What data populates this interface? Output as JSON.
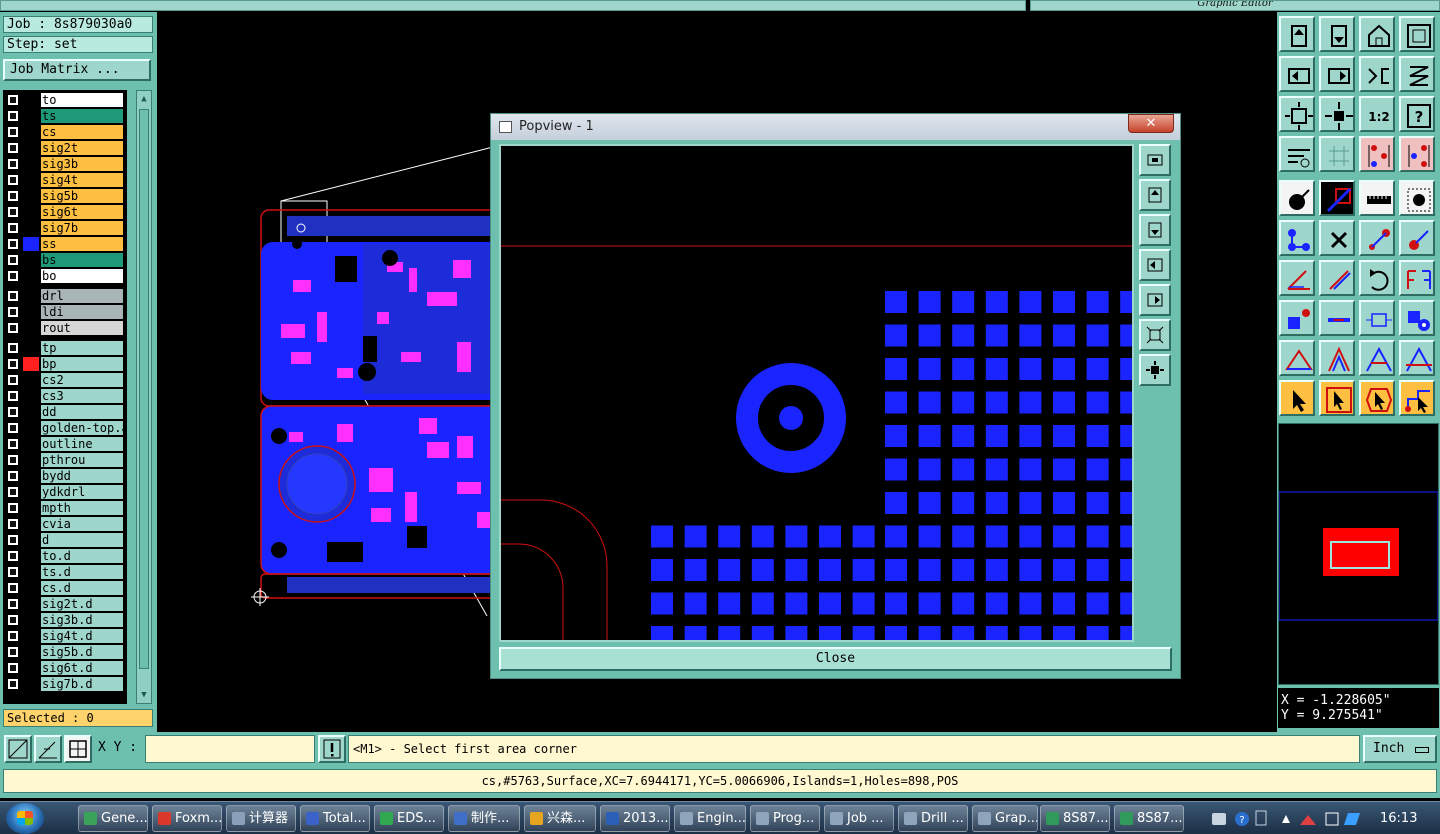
{
  "window": {
    "right_title": "Graphic Editor"
  },
  "job": {
    "job_line": "Job : 8s879030a0",
    "step_line": "Step: set",
    "matrix_button": "Job Matrix ..."
  },
  "layers": [
    {
      "name": "to",
      "color": "#ffffff",
      "swatch": ""
    },
    {
      "name": "ts",
      "color": "#1e9a78",
      "swatch": ""
    },
    {
      "name": "cs",
      "color": "#ffbf40",
      "swatch": ""
    },
    {
      "name": "sig2t",
      "color": "#ffbf40",
      "swatch": ""
    },
    {
      "name": "sig3b",
      "color": "#ffbf40",
      "swatch": ""
    },
    {
      "name": "sig4t",
      "color": "#ffbf40",
      "swatch": ""
    },
    {
      "name": "sig5b",
      "color": "#ffbf40",
      "swatch": ""
    },
    {
      "name": "sig6t",
      "color": "#ffbf40",
      "swatch": ""
    },
    {
      "name": "sig7b",
      "color": "#ffbf40",
      "swatch": ""
    },
    {
      "name": "ss",
      "color": "#ffbf40",
      "swatch": "#1a24ff"
    },
    {
      "name": "bs",
      "color": "#1e9a78",
      "swatch": ""
    },
    {
      "name": "bo",
      "color": "#ffffff",
      "swatch": ""
    },
    {
      "name": "drl",
      "color": "#a9b4b8",
      "swatch": ""
    },
    {
      "name": "ldi",
      "color": "#a9b4b8",
      "swatch": ""
    },
    {
      "name": "rout",
      "color": "#d6d6d6",
      "swatch": ""
    },
    {
      "name": "tp",
      "color": "#9fd6cc",
      "swatch": ""
    },
    {
      "name": "bp",
      "color": "#9fd6cc",
      "swatch": "#ff2020"
    },
    {
      "name": "cs2",
      "color": "#9fd6cc",
      "swatch": ""
    },
    {
      "name": "cs3",
      "color": "#9fd6cc",
      "swatch": ""
    },
    {
      "name": "dd",
      "color": "#9fd6cc",
      "swatch": ""
    },
    {
      "name": "golden-top.a",
      "color": "#9fd6cc",
      "swatch": ""
    },
    {
      "name": "outline",
      "color": "#9fd6cc",
      "swatch": ""
    },
    {
      "name": "pthrou",
      "color": "#9fd6cc",
      "swatch": ""
    },
    {
      "name": "bydd",
      "color": "#9fd6cc",
      "swatch": ""
    },
    {
      "name": "ydkdrl",
      "color": "#9fd6cc",
      "swatch": ""
    },
    {
      "name": "mpth",
      "color": "#9fd6cc",
      "swatch": ""
    },
    {
      "name": "cvia",
      "color": "#9fd6cc",
      "swatch": ""
    },
    {
      "name": "d",
      "color": "#9fd6cc",
      "swatch": ""
    },
    {
      "name": "to.d",
      "color": "#9fd6cc",
      "swatch": ""
    },
    {
      "name": "ts.d",
      "color": "#9fd6cc",
      "swatch": ""
    },
    {
      "name": "cs.d",
      "color": "#9fd6cc",
      "swatch": ""
    },
    {
      "name": "sig2t.d",
      "color": "#9fd6cc",
      "swatch": ""
    },
    {
      "name": "sig3b.d",
      "color": "#9fd6cc",
      "swatch": ""
    },
    {
      "name": "sig4t.d",
      "color": "#9fd6cc",
      "swatch": ""
    },
    {
      "name": "sig5b.d",
      "color": "#9fd6cc",
      "swatch": ""
    },
    {
      "name": "sig6t.d",
      "color": "#9fd6cc",
      "swatch": ""
    },
    {
      "name": "sig7b.d",
      "color": "#9fd6cc",
      "swatch": ""
    }
  ],
  "selected": "Selected : 0",
  "popview": {
    "title": "Popview - 1",
    "close_x": "✕",
    "close_button": "Close"
  },
  "coords": {
    "x": "X = -1.228605\"",
    "y": "Y = 9.275541\""
  },
  "bottom": {
    "xy_label": "X Y :",
    "xy_value": "",
    "prompt": "<M1> - Select first area corner",
    "unit": "Inch"
  },
  "status": "cs,#5763,Surface,XC=7.6944171,YC=5.0066906,Islands=1,Holes=898,POS",
  "taskbar": {
    "items": [
      {
        "label": "Gene...",
        "color": "#3aa35a"
      },
      {
        "label": "Foxm...",
        "color": "#d9382a"
      },
      {
        "label": "计算器",
        "color": "#8aa0b8"
      },
      {
        "label": "Total...",
        "color": "#3a62c9"
      },
      {
        "label": "EDS...",
        "color": "#2fa84f"
      },
      {
        "label": "制作...",
        "color": "#3f6fc7"
      },
      {
        "label": "兴森...",
        "color": "#e5a521"
      },
      {
        "label": "2013...",
        "color": "#2b5fb8"
      },
      {
        "label": "Engin...",
        "color": "#8fa5bb"
      },
      {
        "label": "Prog...",
        "color": "#8fa5bb"
      },
      {
        "label": "Job ...",
        "color": "#8fa5bb"
      },
      {
        "label": "Drill ...",
        "color": "#8fa5bb"
      },
      {
        "label": "Grap...",
        "color": "#8fa5bb"
      },
      {
        "label": "8S87...",
        "color": "#2f9a5a"
      },
      {
        "label": "8S87...",
        "color": "#2f9a5a"
      }
    ],
    "clock": "16:13"
  },
  "colors": {
    "panel": "#6dbfae",
    "pad_blue": "#1a24ff",
    "trace_red": "#d01010"
  }
}
